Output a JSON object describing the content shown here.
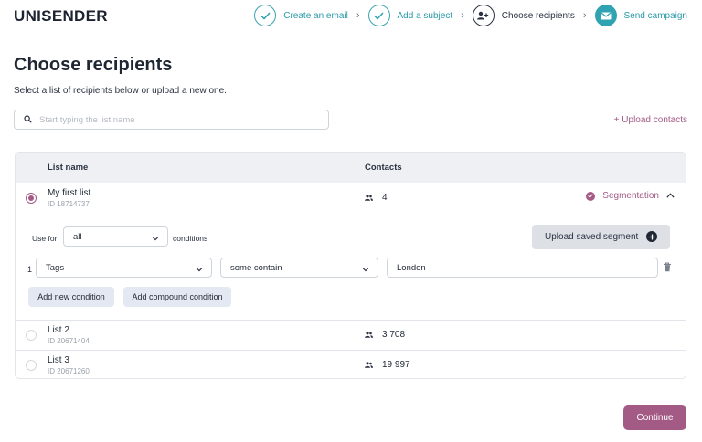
{
  "brand": {
    "logo": "UNISENDER"
  },
  "steps": [
    {
      "label": "Create an email",
      "state": "done"
    },
    {
      "label": "Add a subject",
      "state": "done"
    },
    {
      "label": "Choose recipients",
      "state": "current"
    },
    {
      "label": "Send campaign",
      "state": "future"
    }
  ],
  "page": {
    "title": "Choose recipients",
    "subtitle": "Select a list of recipients below or upload a new one."
  },
  "search": {
    "placeholder": "Start typing the list name",
    "value": ""
  },
  "upload_contacts": "+ Upload contacts",
  "table": {
    "headers": {
      "name": "List name",
      "contacts": "Contacts"
    },
    "rows": [
      {
        "name": "My first list",
        "id": "ID 18714737",
        "contacts": "4",
        "selected": true
      },
      {
        "name": "List 2",
        "id": "ID 20671404",
        "contacts": "3 708",
        "selected": false
      },
      {
        "name": "List 3",
        "id": "ID 20671260",
        "contacts": "19 997",
        "selected": false
      }
    ]
  },
  "segmentation": {
    "label": "Segmentation",
    "use_for_label": "Use for",
    "use_for_value": "all",
    "conditions_label": "conditions",
    "upload_saved_segment": "Upload saved segment",
    "condition": {
      "index": "1",
      "field": "Tags",
      "operator": "some contain",
      "value": "London"
    },
    "add_condition": "Add new condition",
    "add_compound": "Add compound condition"
  },
  "continue_label": "Continue",
  "colors": {
    "accent": "#a35b85",
    "teal": "#2fa3b1",
    "dark": "#1f2733"
  }
}
